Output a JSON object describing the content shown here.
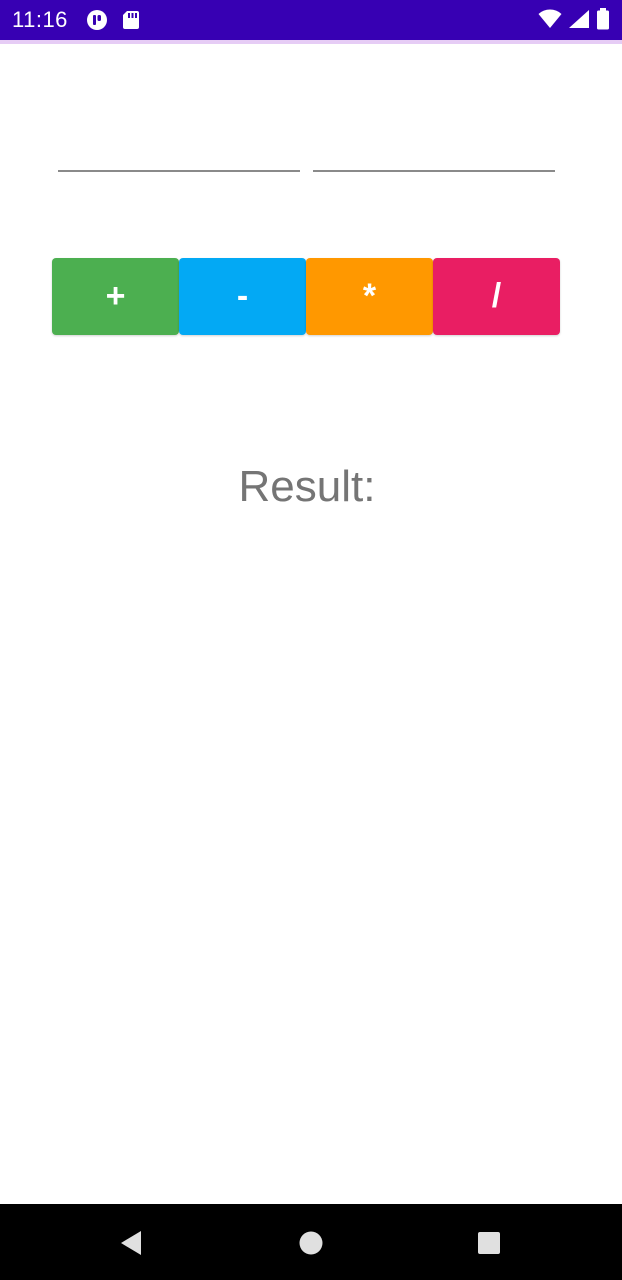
{
  "status_bar": {
    "time": "11:16",
    "color": "#3700b3",
    "left_icons": [
      "podcast-app-icon",
      "sd-card-icon"
    ],
    "right_icons": [
      "wifi-icon",
      "cellular-signal-icon",
      "battery-icon"
    ]
  },
  "inputs": {
    "first_number": {
      "value": "",
      "placeholder": ""
    },
    "second_number": {
      "value": "",
      "placeholder": ""
    }
  },
  "operations": [
    {
      "label": "+",
      "color": "#4caf50"
    },
    {
      "label": "-",
      "color": "#03a9f4"
    },
    {
      "label": "*",
      "color": "#ff9800"
    },
    {
      "label": "/",
      "color": "#e91e63"
    }
  ],
  "result": {
    "label": "Result:"
  },
  "nav_bar": {
    "buttons": [
      "back-icon",
      "home-icon",
      "recents-icon"
    ]
  }
}
